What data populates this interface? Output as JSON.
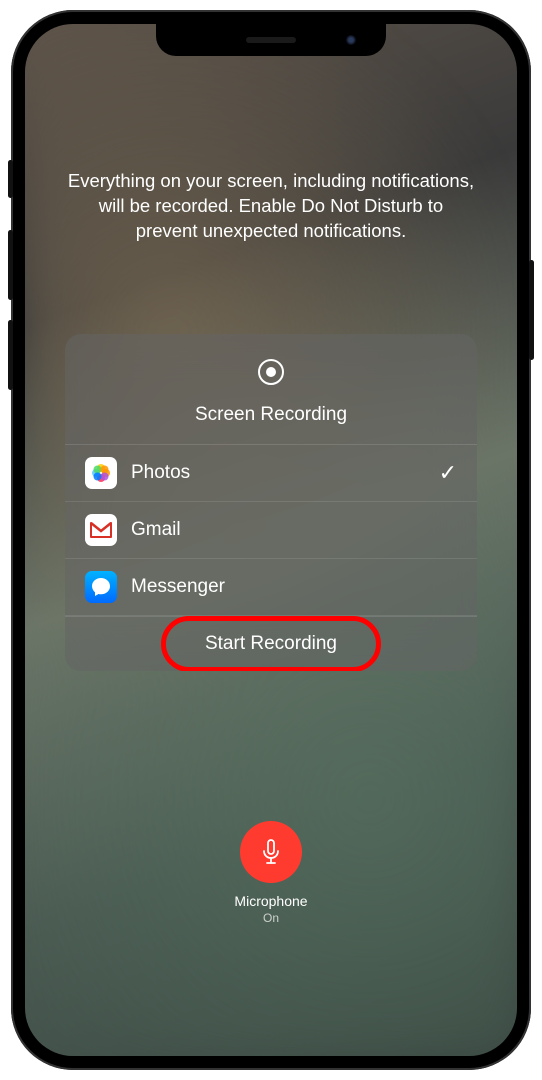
{
  "description": "Everything on your screen, including notifications, will be recorded. Enable Do Not Disturb to prevent unexpected notifications.",
  "card": {
    "title": "Screen Recording",
    "apps": [
      {
        "name": "Photos",
        "selected": true
      },
      {
        "name": "Gmail",
        "selected": false
      },
      {
        "name": "Messenger",
        "selected": false
      }
    ],
    "action": "Start Recording"
  },
  "microphone": {
    "label": "Microphone",
    "status": "On"
  }
}
